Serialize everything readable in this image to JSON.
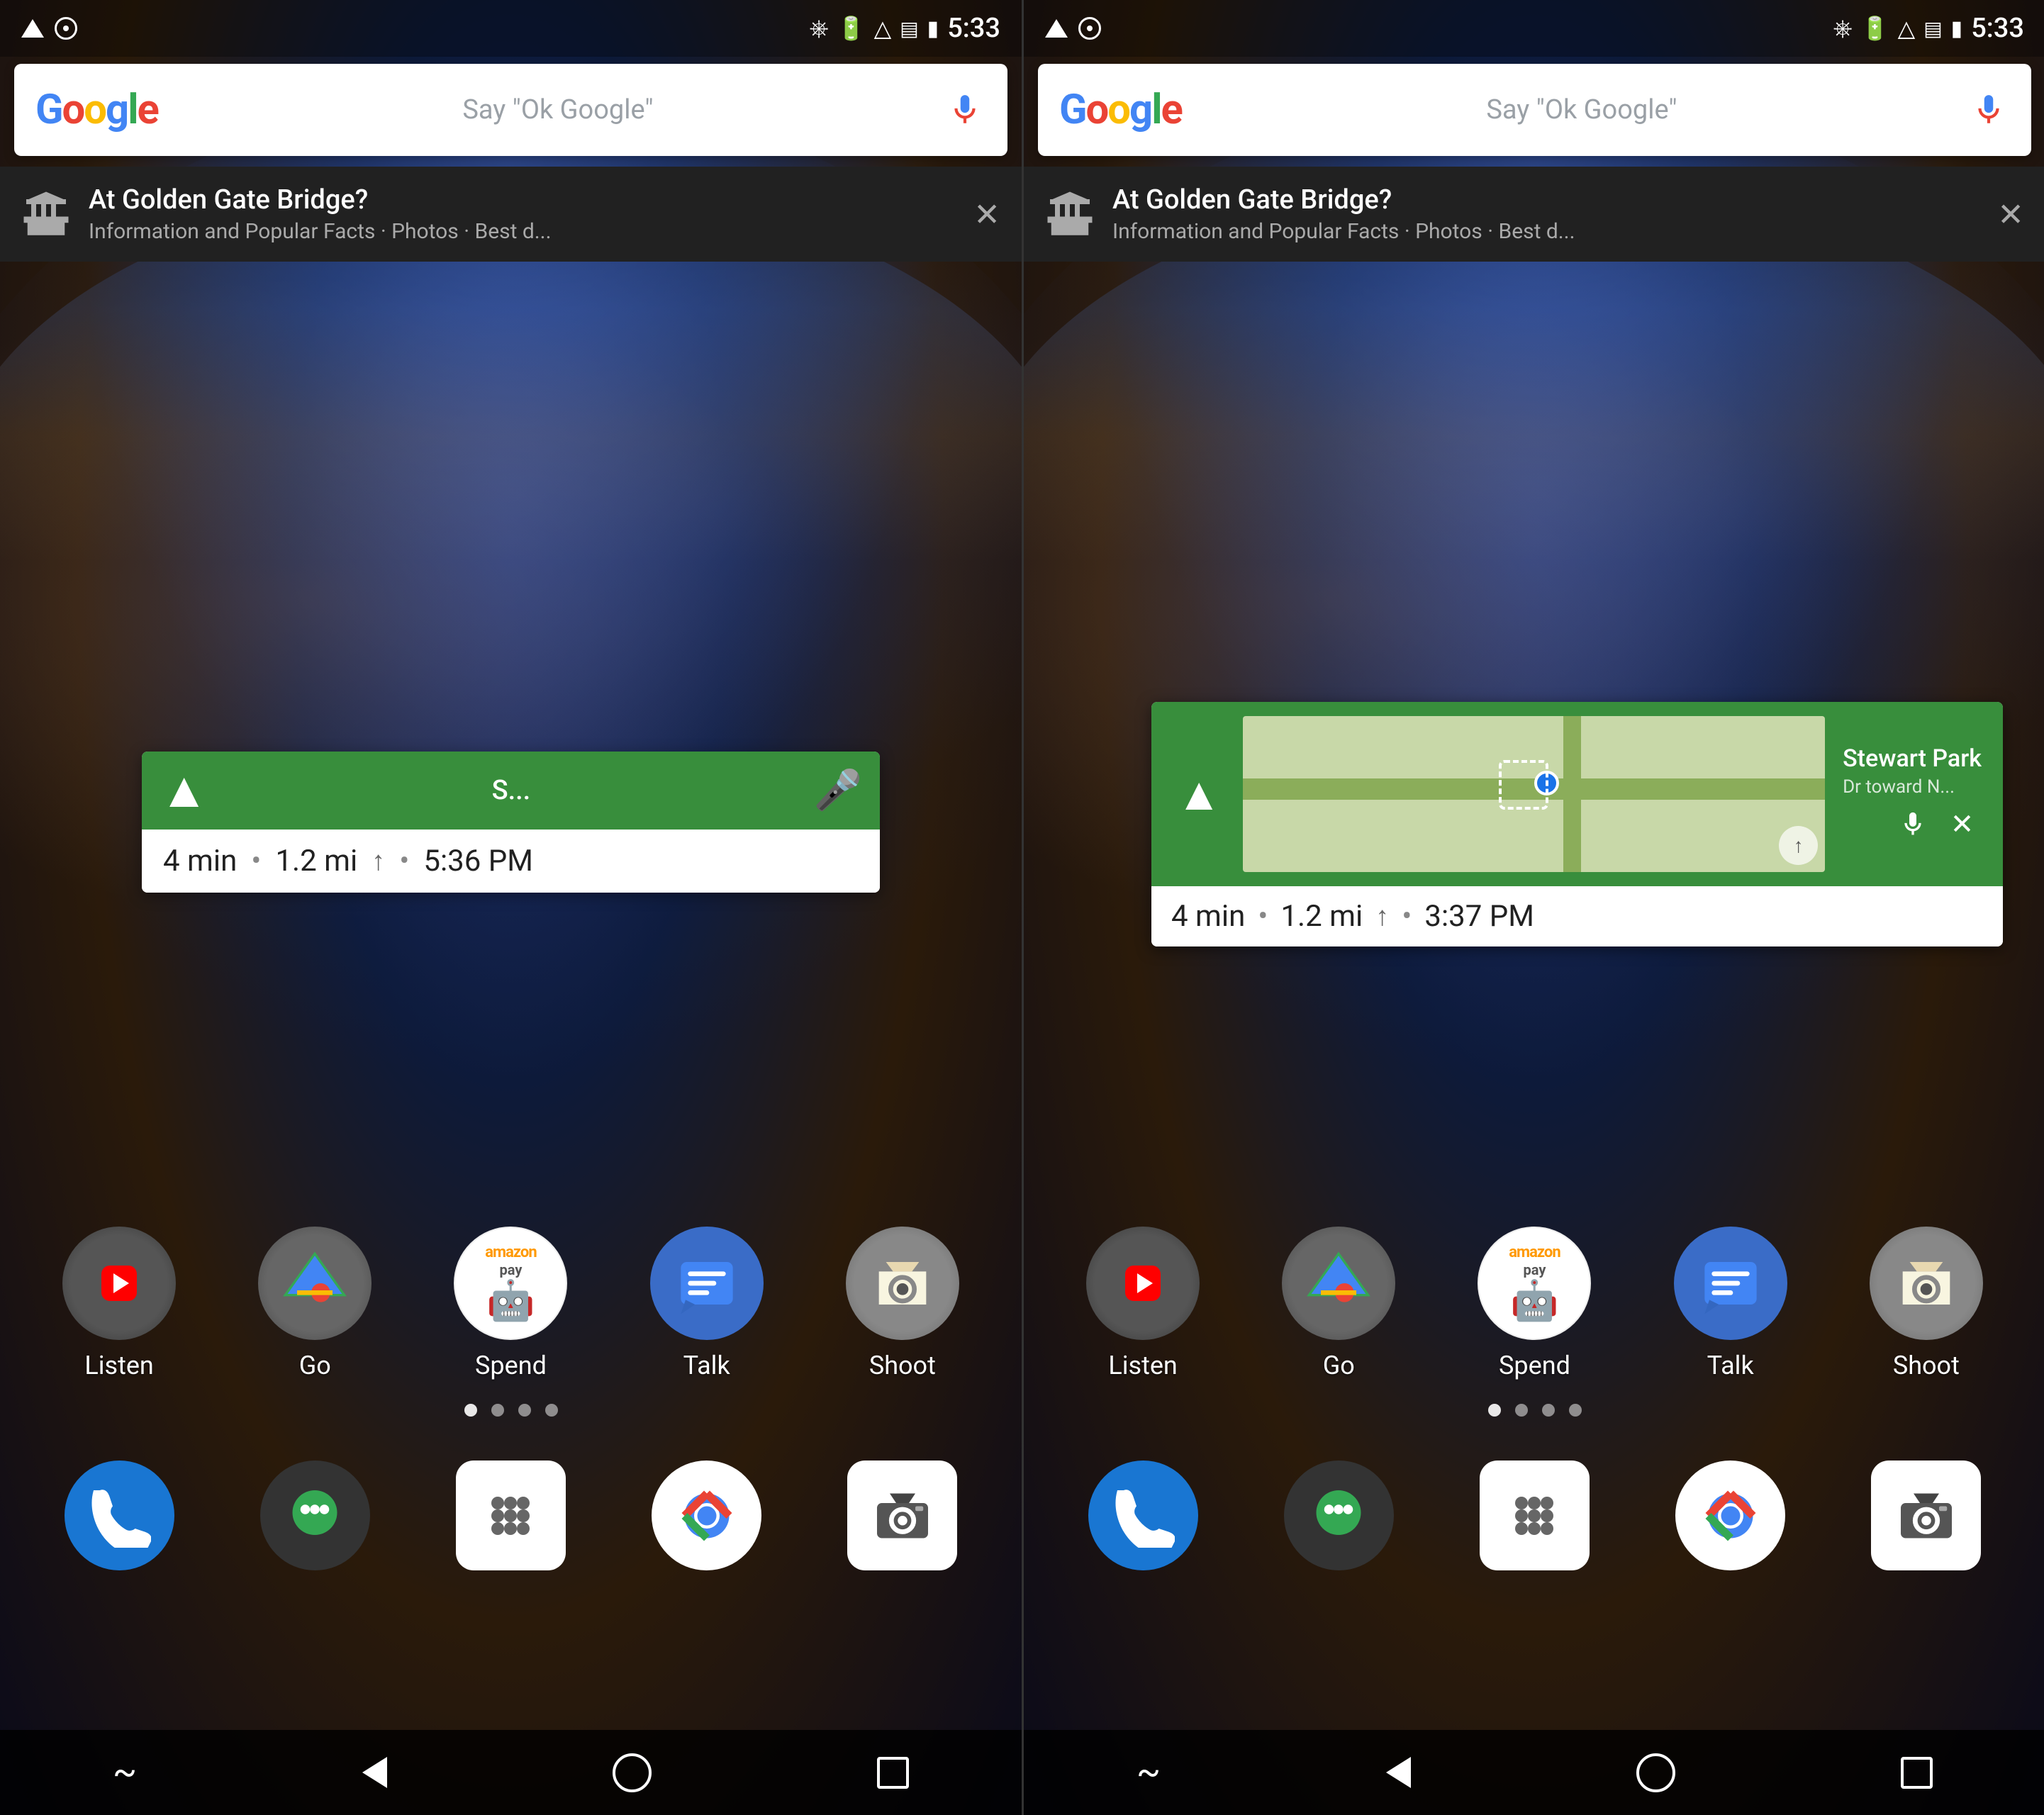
{
  "left_panel": {
    "status_bar": {
      "time": "5:33",
      "nav_label": "navigation",
      "location_label": "location"
    },
    "google_search": {
      "logo": "Google",
      "placeholder": "Say \"Ok Google\"",
      "mic_label": "microphone"
    },
    "now_card": {
      "title": "At Golden Gate Bridge?",
      "subtitle": "Information and Popular Facts · Photos · Best d...",
      "close_label": "close"
    },
    "nav_widget": {
      "destination": "S...",
      "duration": "4 min",
      "distance": "1.2 mi",
      "arrival": "5:36 PM"
    },
    "apps": [
      {
        "label": "Listen",
        "icon": "listen-icon"
      },
      {
        "label": "Go",
        "icon": "go-icon"
      },
      {
        "label": "Spend",
        "icon": "spend-icon"
      },
      {
        "label": "Talk",
        "icon": "talk-icon"
      },
      {
        "label": "Shoot",
        "icon": "shoot-icon"
      }
    ],
    "page_dots": 4,
    "active_dot": 1,
    "dock": [
      {
        "label": "phone",
        "icon": "phone-icon"
      },
      {
        "label": "hangouts",
        "icon": "hangouts-icon"
      },
      {
        "label": "apps",
        "icon": "apps-icon"
      },
      {
        "label": "chrome",
        "icon": "chrome-icon"
      },
      {
        "label": "camera",
        "icon": "camera-icon"
      }
    ],
    "nav_bar": {
      "back": "back",
      "home": "home",
      "recents": "recents",
      "tilde": "menu"
    }
  },
  "right_panel": {
    "status_bar": {
      "time": "5:33"
    },
    "google_search": {
      "logo": "Google",
      "placeholder": "Say \"Ok Google\""
    },
    "now_card": {
      "title": "At Golden Gate Bridge?",
      "subtitle": "Information and Popular Facts · Photos · Best d...",
      "close_label": "close"
    },
    "maps_widget": {
      "destination": "Stewart Park",
      "street": "Dr toward N...",
      "duration": "4 min",
      "distance": "1.2 mi",
      "arrival": "3:37 PM"
    },
    "apps": [
      {
        "label": "Listen",
        "icon": "listen-icon"
      },
      {
        "label": "Go",
        "icon": "go-icon"
      },
      {
        "label": "Spend",
        "icon": "spend-icon"
      },
      {
        "label": "Talk",
        "icon": "talk-icon"
      },
      {
        "label": "Shoot",
        "icon": "shoot-icon"
      }
    ],
    "page_dots": 4,
    "active_dot": 1
  },
  "colors": {
    "google_blue": "#4285F4",
    "google_red": "#EA4335",
    "google_yellow": "#FBBC04",
    "google_green": "#34A853",
    "maps_green": "#388E3C",
    "status_bar_bg": "rgba(0,0,0,0.3)"
  }
}
